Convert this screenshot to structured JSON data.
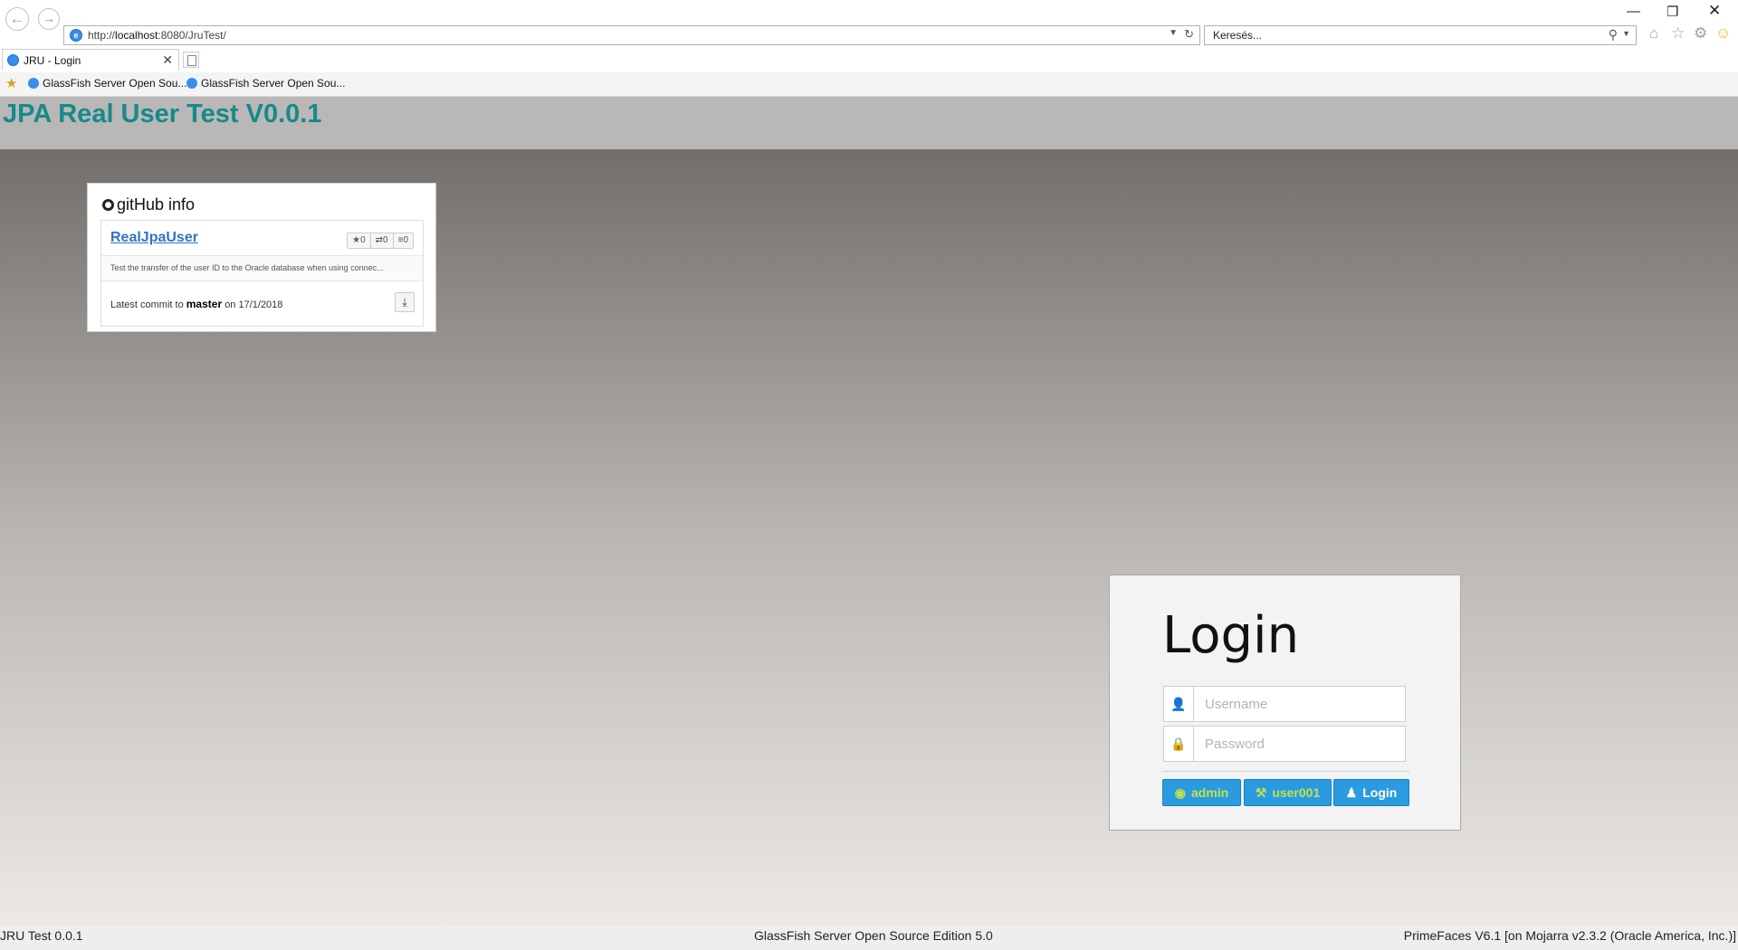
{
  "browser": {
    "url_prefix": "http://",
    "url_host": "localhost",
    "url_rest": ":8080/JruTest/",
    "search_placeholder": "Keresés...",
    "tab_title": "JRU - Login",
    "favorites": [
      {
        "label": "GlassFish Server Open Sou..."
      },
      {
        "label": "GlassFish Server Open Sou..."
      }
    ]
  },
  "header": {
    "title": "JPA Real User Test V0.0.1"
  },
  "github": {
    "heading": "gitHub info",
    "repo_name": "RealJpaUser",
    "stars": "0",
    "forks": "0",
    "issues": "0",
    "description": "Test the transfer of the user ID to the Oracle database when using connec...",
    "commit_prefix": "Latest commit to",
    "branch": "master",
    "commit_date": "on 17/1/2018"
  },
  "login": {
    "title": "Login",
    "username_placeholder": "Username",
    "password_placeholder": "Password",
    "admin_label": "admin",
    "user_label": "user001",
    "login_label": "Login"
  },
  "footer": {
    "left": "JRU Test 0.0.1",
    "center": "GlassFish Server Open Source Edition 5.0",
    "right": "PrimeFaces V6.1 [on Mojarra v2.3.2 (Oracle America, Inc.)]"
  }
}
